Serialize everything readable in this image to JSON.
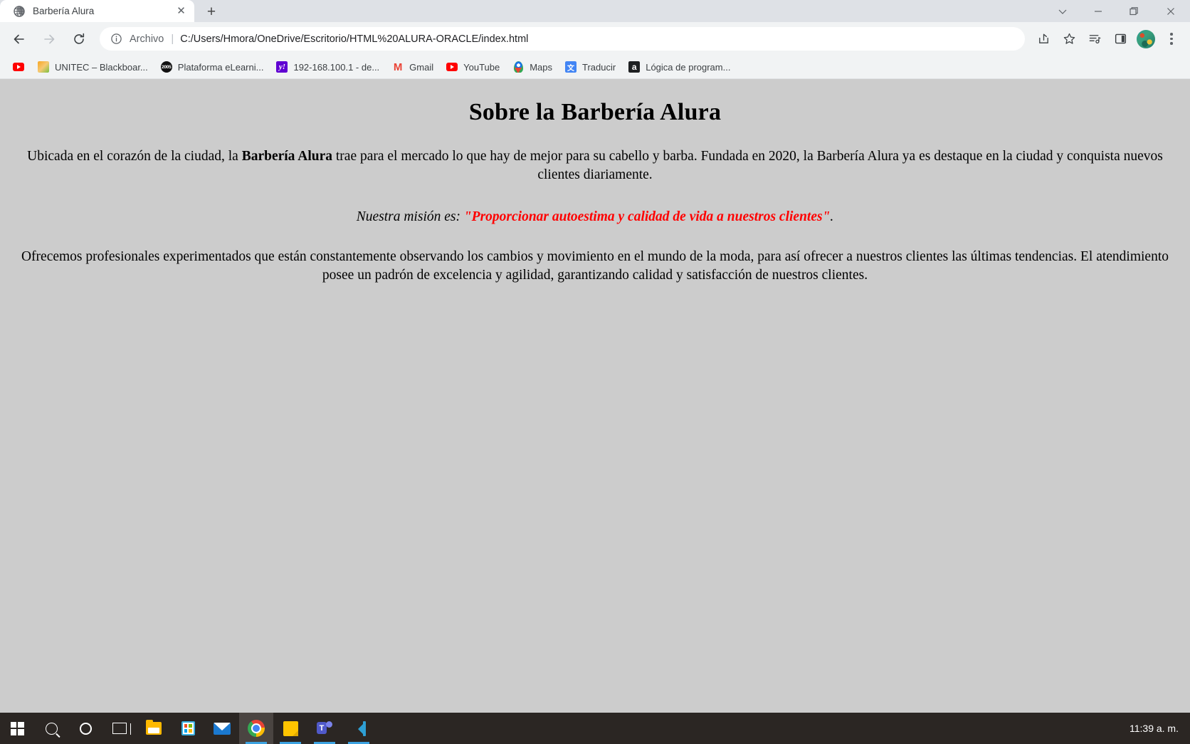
{
  "browser": {
    "tab": {
      "title": "Barbería Alura",
      "favicon": "globe-icon",
      "close_label": "✕"
    },
    "newtab_label": "+",
    "window_controls": {
      "more_label": "⌄",
      "minimize_label": "—",
      "restore_label": "❐",
      "close_label": "✕"
    },
    "nav": {
      "back_label": "←",
      "forward_label": "→",
      "reload_label": "⟳"
    },
    "omnibox": {
      "info_icon": "info-circle-icon",
      "scheme_label": "Archivo",
      "separator": "|",
      "url": "C:/Users/Hmora/OneDrive/Escritorio/HTML%20ALURA-ORACLE/index.html"
    },
    "toolbar_icons": [
      {
        "name": "share-icon",
        "label": ""
      },
      {
        "name": "bookmark-star-icon",
        "label": ""
      },
      {
        "name": "reading-list-icon",
        "label": ""
      },
      {
        "name": "side-panel-icon",
        "label": ""
      },
      {
        "name": "profile-avatar",
        "label": ""
      },
      {
        "name": "chrome-menu-icon",
        "label": ""
      }
    ],
    "bookmarks": [
      {
        "icon": "youtube-icon",
        "label": "",
        "icon_only": true
      },
      {
        "icon": "pencil-icon",
        "label": "UNITEC – Blackboar..."
      },
      {
        "icon": "badge-2005-icon",
        "label": "Plataforma eLearni..."
      },
      {
        "icon": "yahoo-icon",
        "label": "192-168.100.1 - de..."
      },
      {
        "icon": "gmail-icon",
        "label": "Gmail"
      },
      {
        "icon": "youtube-icon",
        "label": "YouTube"
      },
      {
        "icon": "maps-pin-icon",
        "label": "Maps"
      },
      {
        "icon": "translate-icon",
        "label": "Traducir"
      },
      {
        "icon": "alura-icon",
        "label": "Lógica de program..."
      }
    ]
  },
  "page": {
    "heading": "Sobre la Barbería Alura",
    "paragraph1": {
      "before": "Ubicada en el corazón de la ciudad, la ",
      "bold": "Barbería Alura",
      "after": " trae para el mercado lo que hay de mejor para su cabello y barba. Fundada en 2020, la Barbería Alura ya es destaque en la ciudad y conquista nuevos clientes diariamente."
    },
    "mission": {
      "intro": "Nuestra misión es: ",
      "quote": "\"Proporcionar autoestima y calidad de vida a nuestros clientes\"",
      "period": "."
    },
    "paragraph3": "Ofrecemos profesionales experimentados que están constantemente observando los cambios y movimiento en el mundo de la moda, para así ofrecer a nuestros clientes las últimas tendencias. El atendimiento posee un padrón de excelencia y agilidad, garantizando calidad y satisfacción de nuestros clientes.",
    "background_color": "#cccccc",
    "quote_color": "#ff0000"
  },
  "taskbar": {
    "items": [
      {
        "name": "start-button",
        "icon": "windows-logo-icon"
      },
      {
        "name": "search-button",
        "icon": "search-icon"
      },
      {
        "name": "cortana-button",
        "icon": "cortana-circle-icon"
      },
      {
        "name": "task-view-button",
        "icon": "task-view-icon"
      },
      {
        "name": "file-explorer-button",
        "icon": "file-explorer-icon"
      },
      {
        "name": "microsoft-store-button",
        "icon": "microsoft-store-icon"
      },
      {
        "name": "mail-button",
        "icon": "mail-icon"
      },
      {
        "name": "chrome-button",
        "icon": "chrome-icon"
      },
      {
        "name": "sticky-notes-button",
        "icon": "sticky-notes-icon"
      },
      {
        "name": "teams-button",
        "icon": "teams-icon"
      },
      {
        "name": "vscode-button",
        "icon": "vscode-icon"
      }
    ],
    "clock": "11:39 a. m."
  }
}
